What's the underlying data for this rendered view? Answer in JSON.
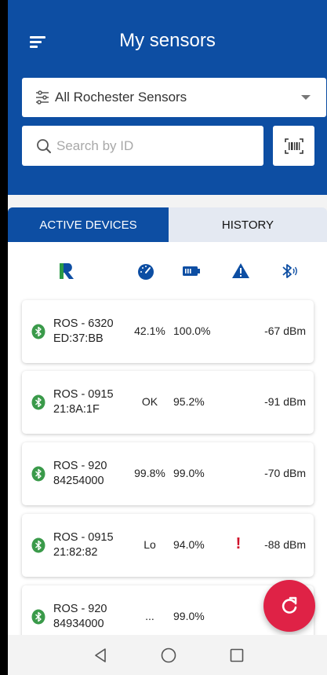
{
  "header": {
    "title": "My sensors",
    "filter": {
      "selected": "All Rochester Sensors"
    },
    "search": {
      "placeholder": "Search by ID",
      "value": ""
    }
  },
  "tabs": [
    {
      "label": "ACTIVE DEVICES",
      "active": true
    },
    {
      "label": "HISTORY",
      "active": false
    }
  ],
  "columns": [
    {
      "icon": "rochester-logo-icon"
    },
    {
      "icon": "gauge-icon"
    },
    {
      "icon": "battery-icon"
    },
    {
      "icon": "warning-icon"
    },
    {
      "icon": "bluetooth-signal-icon"
    }
  ],
  "devices": [
    {
      "name": "ROS - 6320",
      "id": "ED:37:BB",
      "level": "42.1%",
      "battery": "100.0%",
      "alert": "",
      "signal": "-67 dBm"
    },
    {
      "name": "ROS - 0915",
      "id": "21:8A:1F",
      "level": "OK",
      "battery": "95.2%",
      "alert": "",
      "signal": "-91 dBm"
    },
    {
      "name": "ROS - 920",
      "id": "84254000",
      "level": "99.8%",
      "battery": "99.0%",
      "alert": "",
      "signal": "-70 dBm"
    },
    {
      "name": "ROS - 0915",
      "id": "21:82:82",
      "level": "Lo",
      "battery": "94.0%",
      "alert": "!",
      "signal": "-88 dBm"
    },
    {
      "name": "ROS - 920",
      "id": "84934000",
      "level": "...",
      "battery": "99.0%",
      "alert": "",
      "signal": ""
    }
  ],
  "colors": {
    "primary": "#0d4ea3",
    "accent": "#df2246",
    "bluetooth_green": "#3a9a4a",
    "alert_red": "#d0102a"
  }
}
